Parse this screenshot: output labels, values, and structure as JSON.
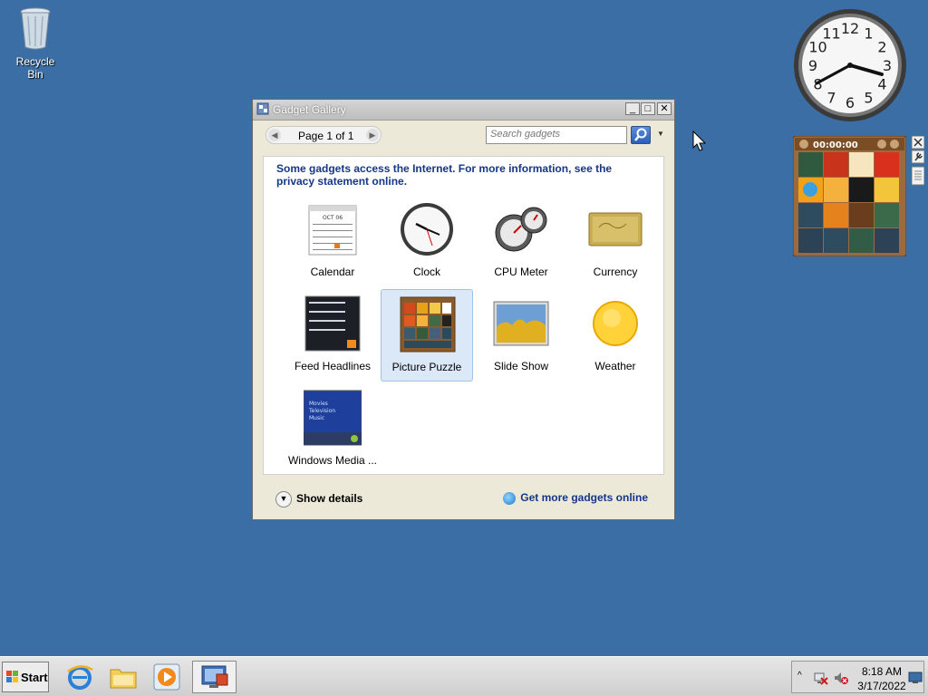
{
  "desktop": {
    "recycle_bin_label": "Recycle Bin"
  },
  "window": {
    "title": "Gadget Gallery",
    "pager_label": "Page 1 of 1",
    "search_placeholder": "Search gadgets",
    "notice": "Some gadgets access the Internet.  For more information, see the privacy statement online.",
    "gadgets": [
      {
        "label": "Calendar",
        "icon": "calendar-icon"
      },
      {
        "label": "Clock",
        "icon": "clock-icon"
      },
      {
        "label": "CPU Meter",
        "icon": "cpu-meter-icon"
      },
      {
        "label": "Currency",
        "icon": "currency-icon"
      },
      {
        "label": "Feed Headlines",
        "icon": "feed-headlines-icon"
      },
      {
        "label": "Picture Puzzle",
        "icon": "picture-puzzle-icon",
        "selected": true
      },
      {
        "label": "Slide Show",
        "icon": "slide-show-icon"
      },
      {
        "label": "Weather",
        "icon": "weather-icon"
      },
      {
        "label": "Windows Media ...",
        "icon": "windows-media-center-icon"
      }
    ],
    "calendar_month": "OCT 06",
    "media_center_menu": [
      "Movies",
      "Television",
      "Music"
    ],
    "show_details_label": "Show details",
    "get_more_label": "Get more gadgets online"
  },
  "sidebar": {
    "clock_numbers": [
      "12",
      "1",
      "2",
      "3",
      "4",
      "5",
      "6",
      "7",
      "8",
      "9",
      "10",
      "11"
    ],
    "puzzle_timer": "00:00:00"
  },
  "taskbar": {
    "start_label": "Start",
    "time": "8:18 AM",
    "date": "3/17/2022"
  },
  "colors": {
    "desktop": "#3a6ea5",
    "link_blue": "#14378a"
  }
}
